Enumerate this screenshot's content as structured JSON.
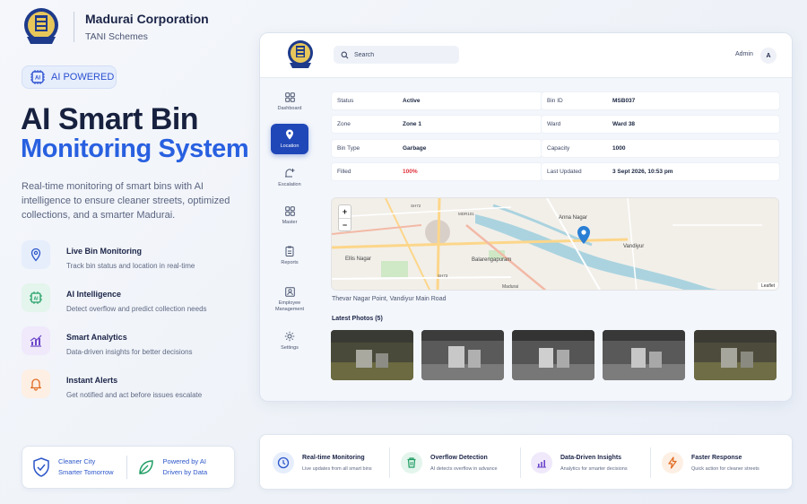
{
  "brand": {
    "name": "Madurai Corporation",
    "subtitle": "TANI Schemes"
  },
  "badge": {
    "label": "AI POWERED"
  },
  "hero": {
    "line1": "AI Smart Bin",
    "line2": "Monitoring System",
    "description": "Real-time monitoring of smart bins with AI intelligence to ensure cleaner streets, optimized collections, and a smarter Madurai."
  },
  "features": [
    {
      "title": "Live Bin Monitoring",
      "desc": "Track bin status and location in real-time",
      "icon": "location-pin-icon",
      "color": "#2b56c9",
      "bg": "#e6eefc"
    },
    {
      "title": "AI Intelligence",
      "desc": "Detect overflow and predict collection needs",
      "icon": "ai-chip-icon",
      "color": "#1f9d63",
      "bg": "#e3f5ec"
    },
    {
      "title": "Smart Analytics",
      "desc": "Data-driven insights for better decisions",
      "icon": "analytics-chart-icon",
      "color": "#6b46c9",
      "bg": "#efe9fb"
    },
    {
      "title": "Instant Alerts",
      "desc": "Get notified and act before issues escalate",
      "icon": "bell-icon",
      "color": "#e06a1f",
      "bg": "#fdefe3"
    }
  ],
  "left_card": {
    "item1": {
      "line1": "Cleaner City",
      "line2": "Smarter Tomorrow",
      "icon": "shield-check-icon"
    },
    "item2": {
      "line1": "Powered by AI",
      "line2": "Driven by Data",
      "icon": "leaf-icon"
    }
  },
  "app": {
    "search_placeholder": "Search",
    "user_label": "Admin",
    "avatar_initial": "A",
    "nav": [
      {
        "label": "Dashboard",
        "icon": "grid-icon",
        "active": false
      },
      {
        "label": "Location",
        "icon": "location-pin-icon",
        "active": true
      },
      {
        "label": "Escalation",
        "icon": "escalation-icon",
        "active": false
      },
      {
        "label": "Master",
        "icon": "grid-icon",
        "active": false
      },
      {
        "label": "Reports",
        "icon": "clipboard-icon",
        "active": false
      },
      {
        "label": "Employee Management",
        "icon": "id-card-icon",
        "active": false
      },
      {
        "label": "Settings",
        "icon": "gear-icon",
        "active": false
      }
    ],
    "info": {
      "status": {
        "key": "Status",
        "value": "Active"
      },
      "bin_id": {
        "key": "Bin ID",
        "value": "MSB037"
      },
      "zone": {
        "key": "Zone",
        "value": "Zone 1"
      },
      "ward": {
        "key": "Ward",
        "value": "Ward 38"
      },
      "bin_type": {
        "key": "Bin Type",
        "value": "Garbage"
      },
      "capacity": {
        "key": "Capacity",
        "value": "1000"
      },
      "filled": {
        "key": "Filled",
        "value": "100%"
      },
      "last_updated": {
        "key": "Last Updated",
        "value": "3 Sept 2026, 10:53 pm"
      }
    },
    "map": {
      "zoom_in": "+",
      "zoom_out": "−",
      "attribution": "Leaflet",
      "labels": {
        "anna_nagar": "Anna Nagar",
        "vandiyur": "Vandiyur",
        "ellis_nagar": "Ellis Nagar",
        "balarengapuram": "Balarengapuram",
        "madurai": "Madurai",
        "road_sh72": "SH72",
        "road_sh73": "SH73",
        "road_mdr": "MDR101"
      }
    },
    "location_caption": "Thevar Nagar Point, Vandiyur Main Road",
    "photos_title": "Latest Photos (5)"
  },
  "strip": [
    {
      "title": "Real-time Monitoring",
      "desc": "Live updates from all smart bins",
      "icon": "clock-icon",
      "color": "#2b56c9",
      "bg": "#e6eefc"
    },
    {
      "title": "Overflow Detection",
      "desc": "AI detects overflow in advance",
      "icon": "trash-bin-icon",
      "color": "#1f9d63",
      "bg": "#e3f5ec"
    },
    {
      "title": "Data-Driven Insights",
      "desc": "Analytics for smarter decisions",
      "icon": "analytics-chart-icon",
      "color": "#6b46c9",
      "bg": "#efe9fb"
    },
    {
      "title": "Faster Response",
      "desc": "Quick action for cleaner streets",
      "icon": "lightning-icon",
      "color": "#e06a1f",
      "bg": "#fdefe3"
    }
  ]
}
